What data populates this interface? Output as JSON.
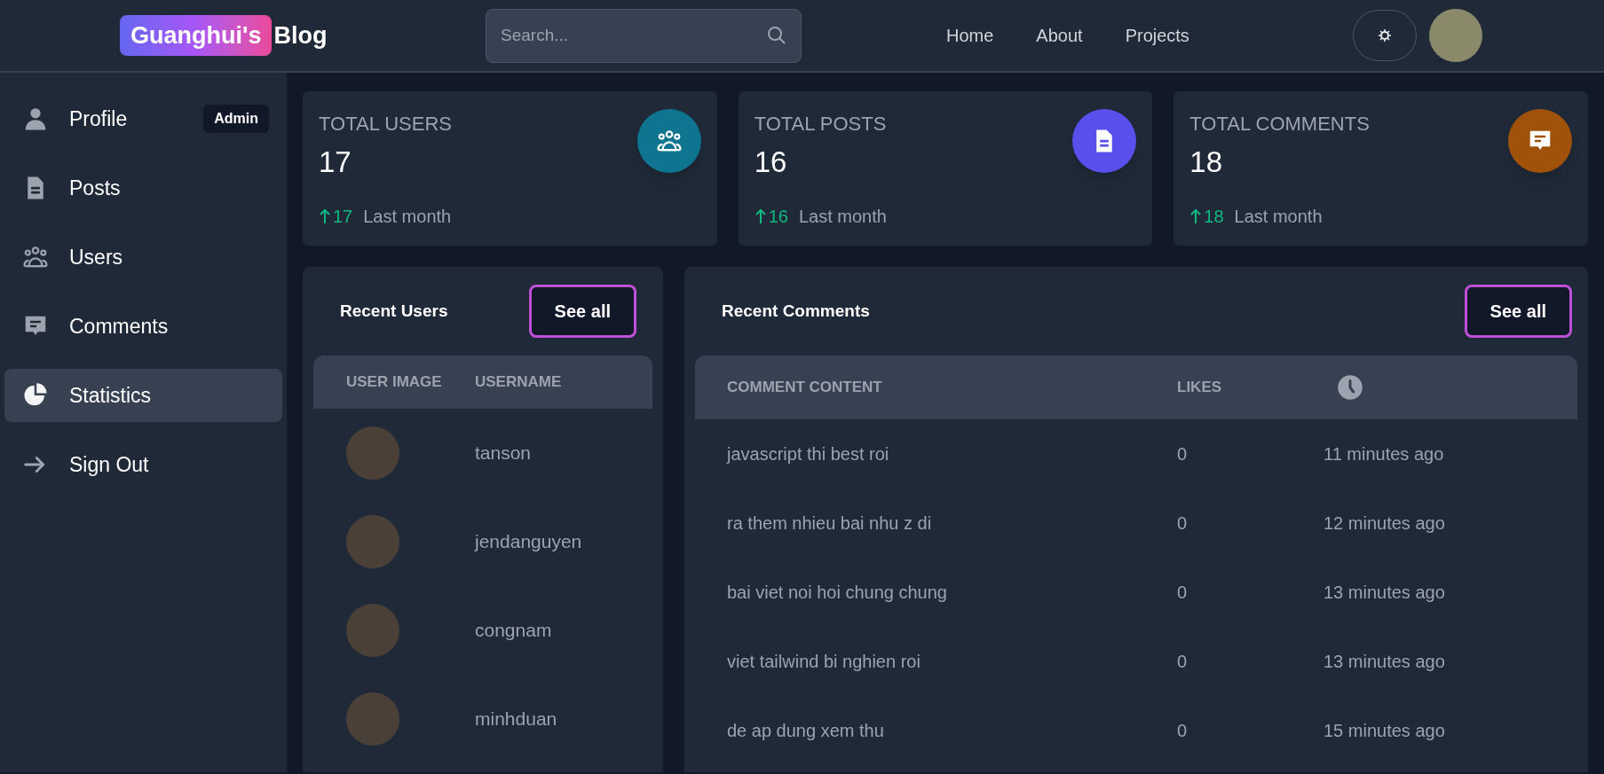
{
  "header": {
    "logo_badge": "Guanghui's",
    "logo_text": "Blog",
    "search": {
      "placeholder": "Search..."
    },
    "nav": [
      "Home",
      "About",
      "Projects"
    ]
  },
  "sidebar": {
    "items": [
      {
        "label": "Profile",
        "kind": "person",
        "badge": "Admin",
        "selected": false
      },
      {
        "label": "Posts",
        "kind": "document",
        "selected": false
      },
      {
        "label": "Users",
        "kind": "group",
        "selected": false
      },
      {
        "label": "Comments",
        "kind": "chat",
        "selected": false
      },
      {
        "label": "Statistics",
        "kind": "pie",
        "selected": true
      },
      {
        "label": "Sign Out",
        "kind": "arrow",
        "selected": false
      }
    ]
  },
  "stats": [
    {
      "title": "TOTAL USERS",
      "value": "17",
      "change": "17",
      "period": "Last month",
      "kind": "group",
      "color": "#0e7490"
    },
    {
      "title": "TOTAL POSTS",
      "value": "16",
      "change": "16",
      "period": "Last month",
      "kind": "document",
      "color": "#5850ec"
    },
    {
      "title": "TOTAL COMMENTS",
      "value": "18",
      "change": "18",
      "period": "Last month",
      "kind": "chat",
      "color": "#a0520a"
    }
  ],
  "recent_users": {
    "title": "Recent Users",
    "button": "See all",
    "columns": [
      "USER IMAGE",
      "USERNAME"
    ],
    "rows": [
      {
        "username": "tanson"
      },
      {
        "username": "jendanguyen"
      },
      {
        "username": "congnam"
      },
      {
        "username": "minhduan"
      }
    ]
  },
  "recent_comments": {
    "title": "Recent Comments",
    "button": "See all",
    "columns": [
      "COMMENT CONTENT",
      "LIKES"
    ],
    "rows": [
      {
        "content": "javascript thi best roi",
        "likes": "0",
        "time": "11 minutes ago"
      },
      {
        "content": "ra them nhieu bai nhu z di",
        "likes": "0",
        "time": "12 minutes ago"
      },
      {
        "content": "bai viet noi hoi chung chung",
        "likes": "0",
        "time": "13 minutes ago"
      },
      {
        "content": "viet tailwind bi nghien roi",
        "likes": "0",
        "time": "13 minutes ago"
      },
      {
        "content": "de ap dung xem thu",
        "likes": "0",
        "time": "15 minutes ago"
      }
    ]
  }
}
